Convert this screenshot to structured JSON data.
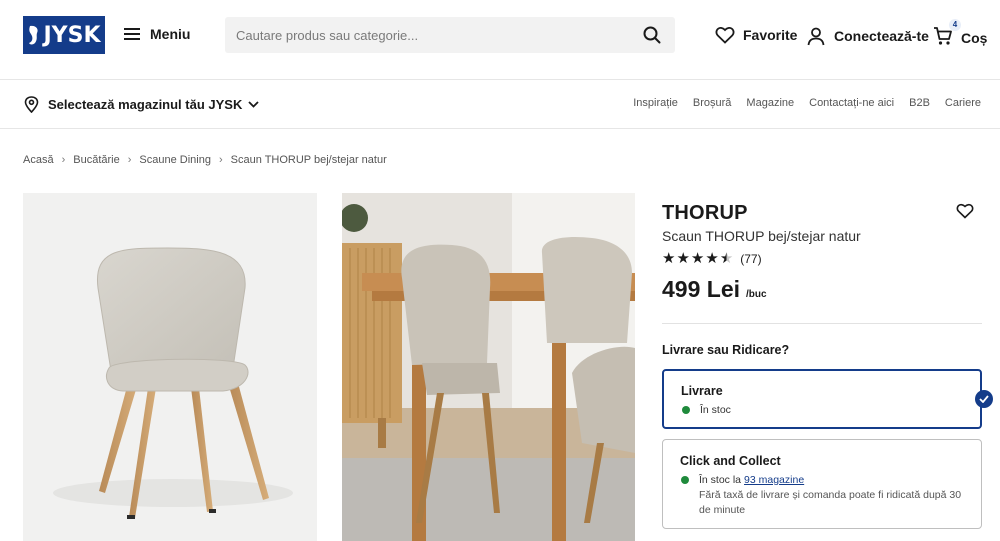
{
  "brand": {
    "logo_text": "JYSK",
    "color": "#143c8a"
  },
  "header": {
    "menu_label": "Meniu",
    "search_placeholder": "Cautare produs sau categorie...",
    "favorites_label": "Favorite",
    "login_label": "Conectează-te",
    "cart_label": "Coș",
    "cart_count": "4"
  },
  "subbar": {
    "store_label": "Selectează magazinul tău JYSK",
    "links": [
      "Inspirație",
      "Broșură",
      "Magazine",
      "Contactați-ne aici",
      "B2B",
      "Cariere"
    ]
  },
  "breadcrumb": [
    "Acasă",
    "Bucătărie",
    "Scaune Dining",
    "Scaun THORUP bej/stejar natur"
  ],
  "product": {
    "title": "THORUP",
    "subtitle": "Scaun THORUP bej/stejar natur",
    "rating": 4.5,
    "reviews": "(77)",
    "price": "499 Lei",
    "unit": "/buc"
  },
  "delivery": {
    "heading": "Livrare sau Ridicare?",
    "options": [
      {
        "title": "Livrare",
        "stock": "În stoc",
        "selected": true
      },
      {
        "title": "Click and Collect",
        "stock_prefix": "În stoc la",
        "stock_link": "93 magazine",
        "note": "Fără taxă de livrare și comanda poate fi ridicată după 30 de minute",
        "selected": false
      }
    ],
    "stock_color": "#1f8a3c"
  }
}
